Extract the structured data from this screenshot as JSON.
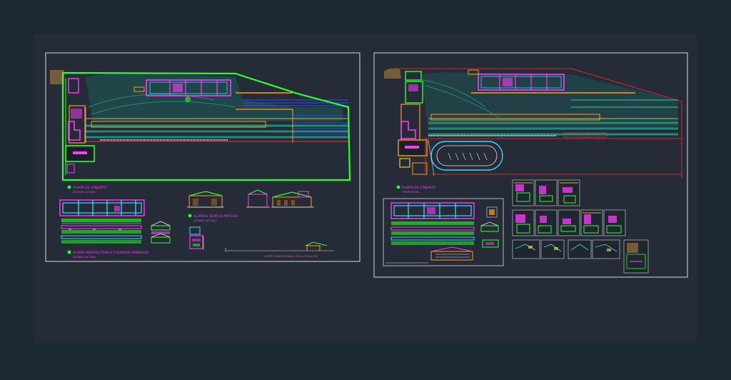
{
  "app": {
    "title": ""
  },
  "colors": {
    "outer_bg": "#1c2a31",
    "canvas_bg": "#252c37",
    "frame": "#d9dde2",
    "green": "#2bff2b",
    "magenta": "#ff38ff",
    "cyan": "#36d8ff",
    "orange": "#ff9a1f",
    "red": "#ff2b2b",
    "blue": "#2f4cff",
    "teal": "#1f8a78",
    "yellow": "#ffe83a",
    "white": "#e6e6e6"
  },
  "sheets": {
    "left": {
      "name": "existing-site-sheet",
      "labels": {
        "site_plan": "PLANTA DE CONJUNTO",
        "site_plan_sub": "(ESTADO ACTUAL)",
        "architectural_plan": "PLANTA ARQUITECTONICA Y ALZADOS GENERALES",
        "architectural_plan_sub": "(ESTADO ACTUAL)",
        "elevation": "ALZADOS, EDIFICIO ANTIGUO",
        "elevation_sub": "(ESTADO ACTUAL)",
        "section": "CORTE LONGITUDINAL DE LA ESTACION"
      }
    },
    "right": {
      "name": "proposal-site-sheet",
      "labels": {
        "site_plan": "PLANTA DE CONJUNTO",
        "site_plan_sub": "(PROPUESTA)"
      }
    }
  },
  "icons": {
    "label_bullet": "green-dot-icon"
  }
}
